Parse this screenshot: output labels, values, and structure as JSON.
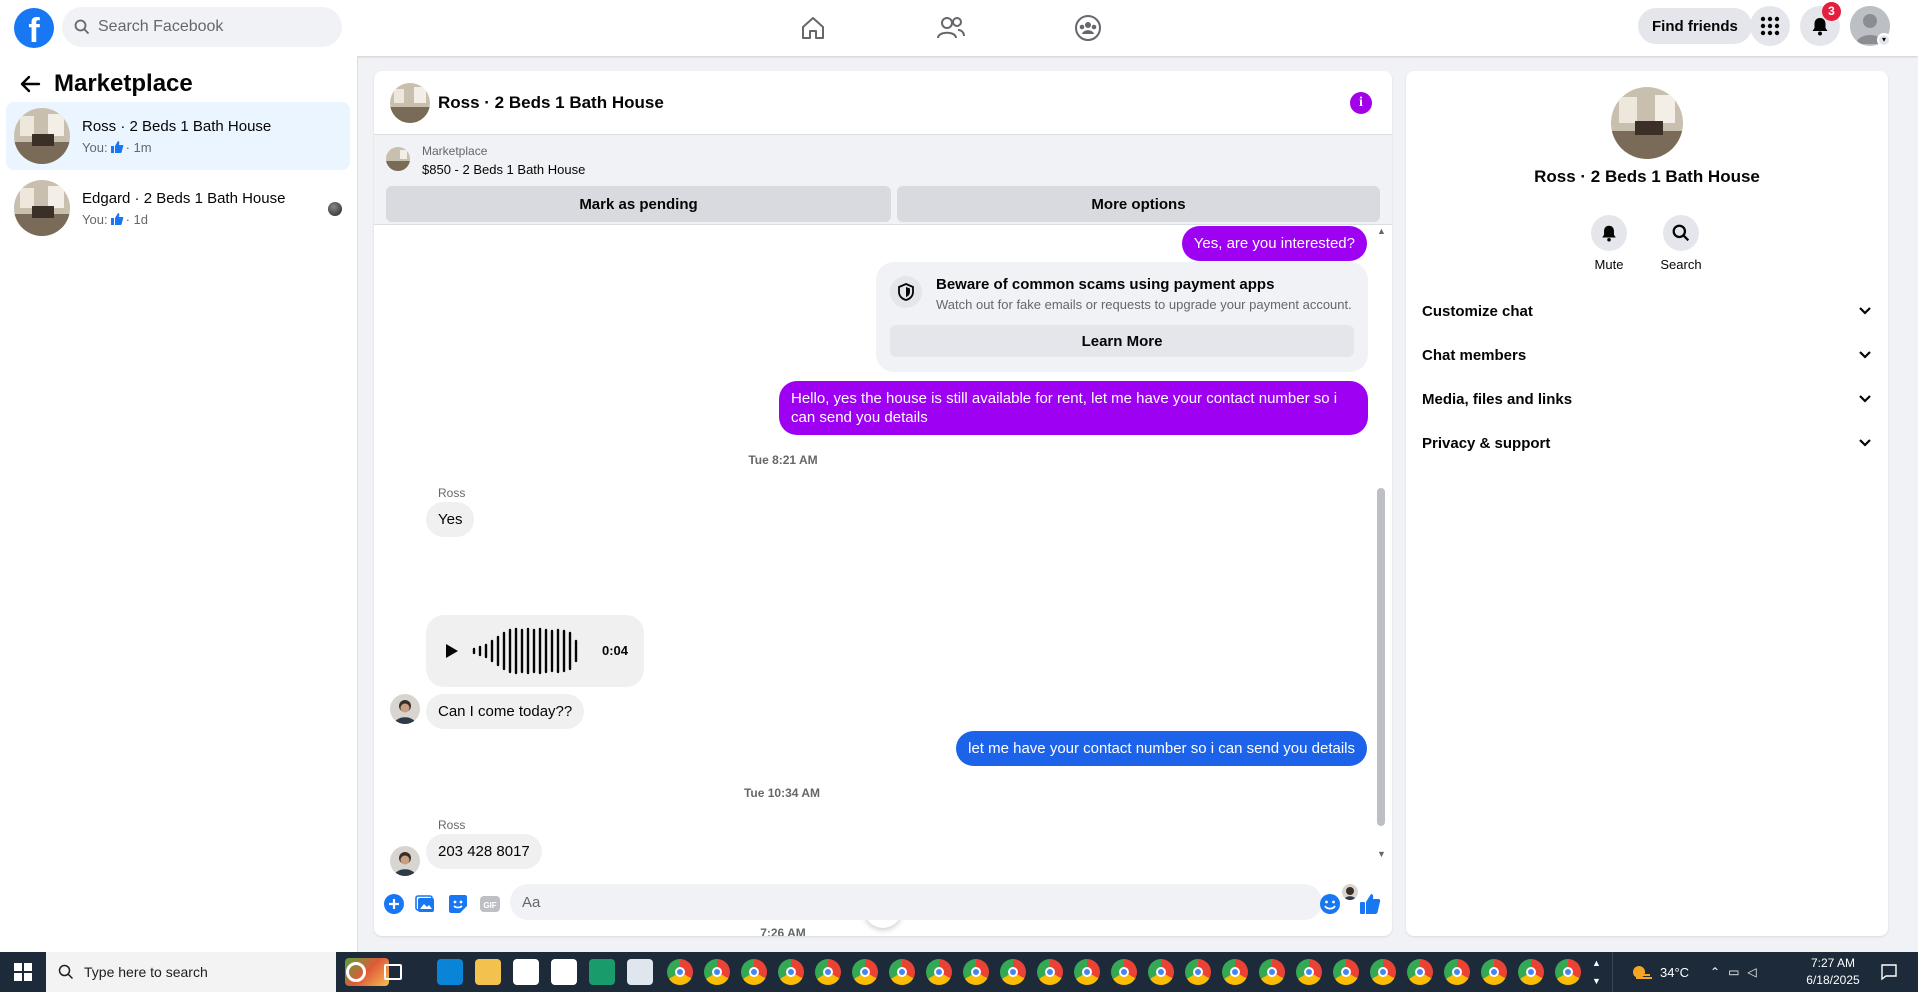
{
  "topbar": {
    "search_placeholder": "Search Facebook",
    "find_friends_label": "Find friends",
    "notification_count": "3",
    "brand_color": "#1877f2"
  },
  "sidebar": {
    "title": "Marketplace",
    "conversations": [
      {
        "name": "Ross · 2 Beds 1 Bath House",
        "you_label": "You:",
        "time": "· 1m"
      },
      {
        "name": "Edgard · 2 Beds 1 Bath House",
        "you_label": "You:",
        "time": "· 1d"
      }
    ]
  },
  "chat": {
    "title": "Ross · 2 Beds 1 Bath House",
    "marketplace_label": "Marketplace",
    "listing": "$850 - 2 Beds 1 Bath House",
    "mark_pending_label": "Mark as pending",
    "more_options_label": "More options",
    "messages": {
      "m1": "Yes, are you interested?",
      "scam_title": "Beware of common scams using payment apps",
      "scam_text": "Watch out for fake emails or requests to upgrade your payment account.",
      "learn_more": "Learn More",
      "m2": "Hello, yes the house is still available for rent, let me have your contact number so i can send you details",
      "ts1": "Tue 8:21 AM",
      "sender1": "Ross",
      "m3": "Yes",
      "voice_duration": "0:04",
      "m4": "Can I come today??",
      "m5": "let me have your contact number so i can send you details",
      "ts2": "Tue 10:34 AM",
      "sender2": "Ross",
      "m6": "203 428 8017",
      "ts3": "7:26 AM"
    },
    "composer_placeholder": "Aa",
    "accent_color": "#9e00f2"
  },
  "right_panel": {
    "name": "Ross · 2 Beds 1 Bath House",
    "mute_label": "Mute",
    "search_label": "Search",
    "sections": [
      "Customize chat",
      "Chat members",
      "Media, files and links",
      "Privacy & support"
    ]
  },
  "taskbar": {
    "search_placeholder": "Type here to search",
    "weather": "34°C",
    "time": "7:27 AM",
    "date": "6/18/2025"
  }
}
